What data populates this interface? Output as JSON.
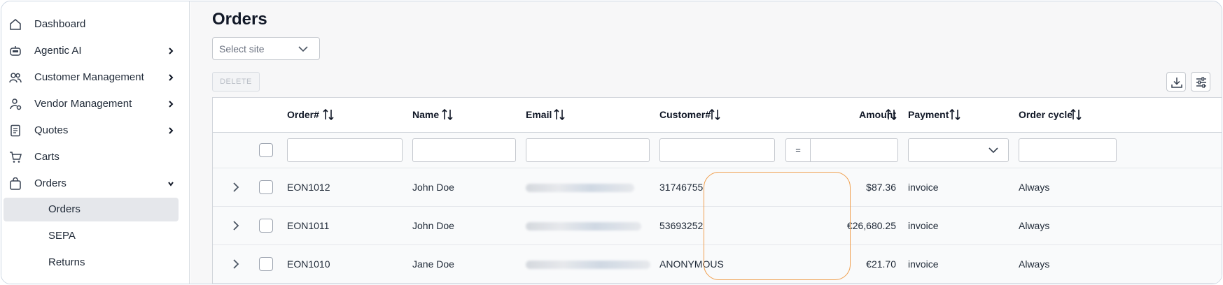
{
  "sidebar": {
    "items": [
      {
        "label": "Dashboard",
        "icon": "home-icon",
        "has_chevron": false
      },
      {
        "label": "Agentic AI",
        "icon": "robot-icon",
        "has_chevron": true
      },
      {
        "label": "Customer Management",
        "icon": "users-icon",
        "has_chevron": true
      },
      {
        "label": "Vendor Management",
        "icon": "user-gear-icon",
        "has_chevron": true
      },
      {
        "label": "Quotes",
        "icon": "document-icon",
        "has_chevron": true
      },
      {
        "label": "Carts",
        "icon": "cart-icon",
        "has_chevron": false
      },
      {
        "label": "Orders",
        "icon": "bag-icon",
        "has_chevron": true,
        "expanded": true
      }
    ],
    "sub_items": [
      {
        "label": "Orders",
        "active": true
      },
      {
        "label": "SEPA",
        "active": false
      },
      {
        "label": "Returns",
        "active": false
      }
    ]
  },
  "page": {
    "title": "Orders",
    "site_select_placeholder": "Select site",
    "delete_label": "DELETE"
  },
  "table": {
    "columns": [
      "Order#",
      "Name",
      "Email",
      "Customer#",
      "Amount",
      "Payment",
      "Order cycle"
    ],
    "amount_filter_operator": "=",
    "rows": [
      {
        "order": "EON1012",
        "name": "John Doe",
        "customer": "31746755",
        "amount": "$87.36",
        "payment": "invoice",
        "cycle": "Always"
      },
      {
        "order": "EON1011",
        "name": "John Doe",
        "customer": "53693252",
        "amount": "€26,680.25",
        "payment": "invoice",
        "cycle": "Always"
      },
      {
        "order": "EON1010",
        "name": "Jane Doe",
        "customer": "ANONYMOUS",
        "amount": "€21.70",
        "payment": "invoice",
        "cycle": "Always"
      }
    ]
  },
  "colors": {
    "highlight": "#f0a050",
    "active_nav_bg": "#e5e7eb"
  }
}
